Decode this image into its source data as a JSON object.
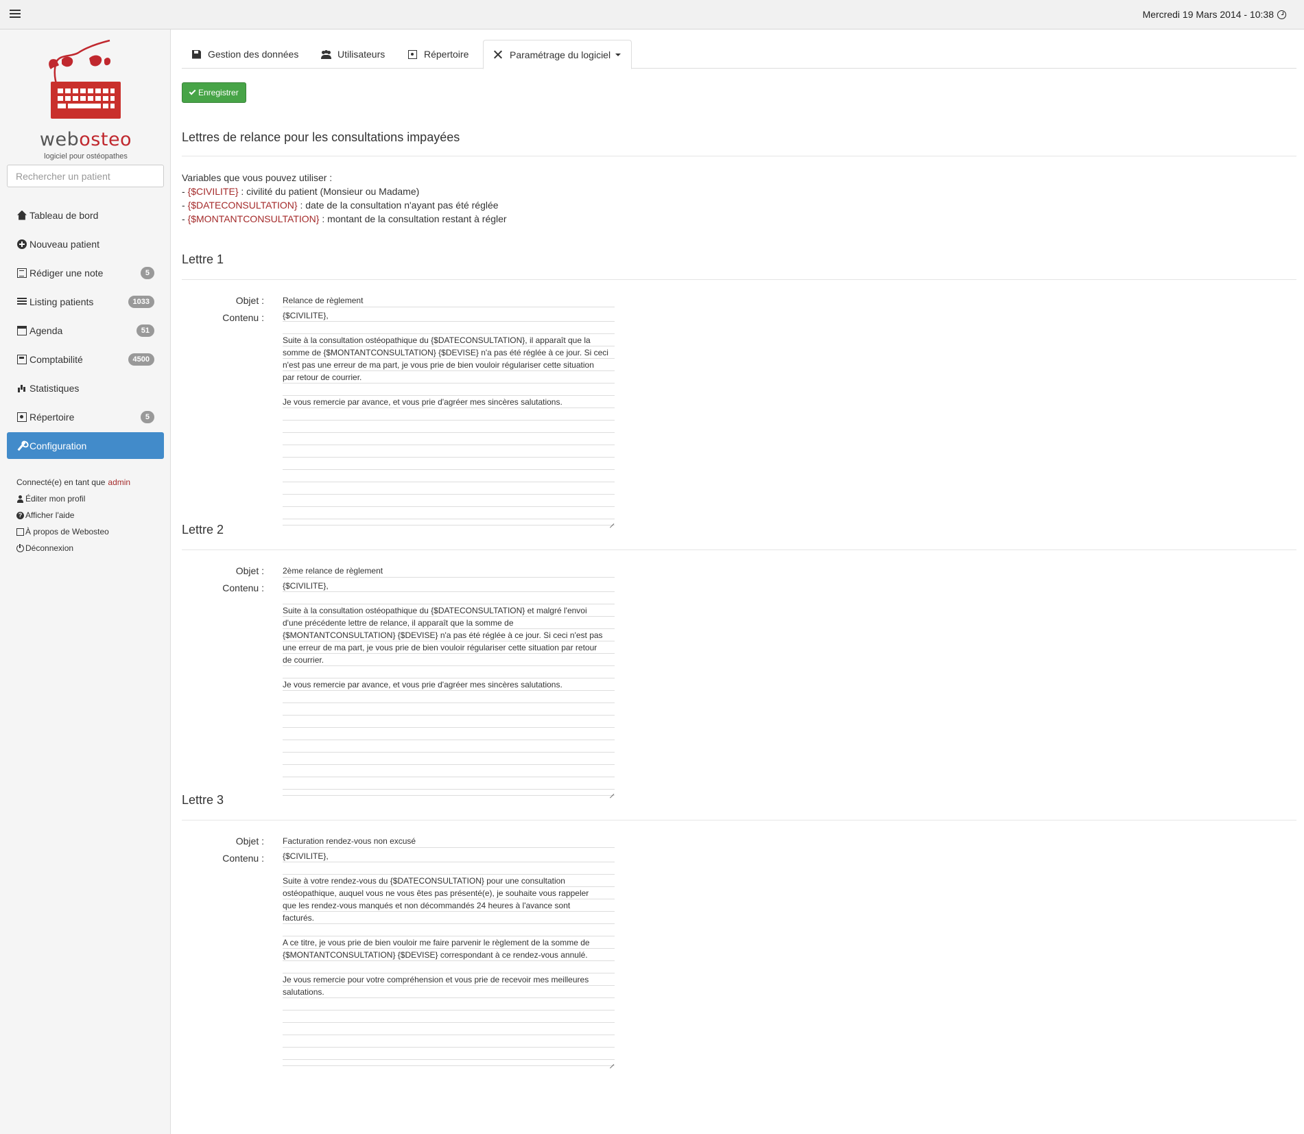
{
  "header": {
    "datetime": "Mercredi 19 Mars 2014 - 10:38"
  },
  "sidebar": {
    "logo": {
      "text_part1": "web",
      "text_part2": "osteo",
      "tagline": "logiciel pour ostéopathes"
    },
    "search_placeholder": "Rechercher un patient",
    "items": [
      {
        "label": "Tableau de bord",
        "icon": "home-icon"
      },
      {
        "label": "Nouveau patient",
        "icon": "plus-circle-icon"
      },
      {
        "label": "Rédiger une note",
        "icon": "note-icon",
        "badge": "5"
      },
      {
        "label": "Listing patients",
        "icon": "list-icon",
        "badge": "1033"
      },
      {
        "label": "Agenda",
        "icon": "calendar-icon",
        "badge": "51"
      },
      {
        "label": "Comptabilité",
        "icon": "calculator-icon",
        "badge": "4500"
      },
      {
        "label": "Statistiques",
        "icon": "stats-icon"
      },
      {
        "label": "Répertoire",
        "icon": "book-icon",
        "badge": "5"
      },
      {
        "label": "Configuration",
        "icon": "wrench-icon",
        "active": true
      }
    ],
    "account": {
      "connected_prefix": "Connecté(e) en tant que",
      "username": "admin",
      "edit_profile": "Éditer mon profil",
      "help": "Afficher l'aide",
      "about": "À propos de Webosteo",
      "logout": "Déconnexion"
    }
  },
  "tabs": [
    {
      "label": "Gestion des données",
      "icon": "save-icon"
    },
    {
      "label": "Utilisateurs",
      "icon": "users-icon"
    },
    {
      "label": "Répertoire",
      "icon": "book-icon"
    },
    {
      "label": "Paramétrage du logiciel",
      "icon": "tools-icon",
      "active": true,
      "dropdown": true
    }
  ],
  "save_button": "Enregistrer",
  "page_heading": "Lettres de relance pour les consultations impayées",
  "variables": {
    "intro": "Variables que vous pouvez utiliser :",
    "items": [
      {
        "name": "{$CIVILITE}",
        "desc": " : civilité du patient (Monsieur ou Madame)"
      },
      {
        "name": "{$DATECONSULTATION}",
        "desc": " : date de la consultation n'ayant pas été réglée"
      },
      {
        "name": "{$MONTANTCONSULTATION}",
        "desc": " : montant de la consultation restant à régler"
      }
    ]
  },
  "labels": {
    "objet": "Objet :",
    "contenu": "Contenu :"
  },
  "letters": [
    {
      "title": "Lettre 1",
      "objet": "Relance de règlement",
      "contenu": "{$CIVILITE},\n\nSuite à la consultation ostéopathique du {$DATECONSULTATION}, il apparaît que la\nsomme de {$MONTANTCONSULTATION} {$DEVISE} n'a pas été réglée à ce jour. Si ceci\nn'est pas une erreur de ma part, je vous prie de bien vouloir régulariser cette situation\npar retour de courrier.\n\nJe vous remercie par avance, et vous prie d'agréer mes sincères salutations."
    },
    {
      "title": "Lettre 2",
      "objet": "2ème relance de règlement",
      "contenu": "{$CIVILITE},\n\nSuite à la consultation ostéopathique du {$DATECONSULTATION} et malgré l'envoi\nd'une précédente lettre de relance, il apparaît que la somme de\n{$MONTANTCONSULTATION} {$DEVISE} n'a pas été réglée à ce jour. Si ceci n'est pas\nune erreur de ma part, je vous prie de bien vouloir régulariser cette situation par retour\nde courrier.\n\nJe vous remercie par avance, et vous prie d'agréer mes sincères salutations."
    },
    {
      "title": "Lettre 3",
      "objet": "Facturation rendez-vous non excusé",
      "contenu": "{$CIVILITE},\n\nSuite à votre rendez-vous du {$DATECONSULTATION} pour une consultation\nostéopathique, auquel vous ne vous êtes pas présenté(e), je souhaite vous rappeler\nque les rendez-vous manqués et non décommandés 24 heures à l'avance sont\nfacturés.\n\nA ce titre, je vous prie de bien vouloir me faire parvenir le règlement de la somme de\n{$MONTANTCONSULTATION} {$DEVISE} correspondant à ce rendez-vous annulé.\n\nJe vous remercie pour votre compréhension et vous prie de recevoir mes meilleures\nsalutations."
    }
  ],
  "colors": {
    "accent": "#428bca",
    "save": "#47a447",
    "brand_red": "#c0282e",
    "badge": "#999999",
    "variable": "#a42a2a"
  }
}
